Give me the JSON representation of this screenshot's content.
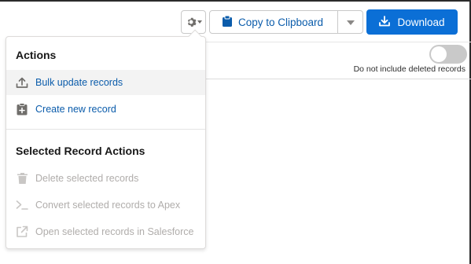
{
  "toolbar": {
    "copy_label": "Copy to Clipboard",
    "download_label": "Download"
  },
  "filters": {
    "toggle_label": "Do not include deleted records",
    "toggle_on": false
  },
  "menu": {
    "actions_heading": "Actions",
    "actions": [
      {
        "label": "Bulk update records",
        "icon": "upload-icon",
        "enabled": true
      },
      {
        "label": "Create new record",
        "icon": "new-record-icon",
        "enabled": true
      }
    ],
    "selected_heading": "Selected Record Actions",
    "selected_actions": [
      {
        "label": "Delete selected records",
        "icon": "trash-icon",
        "enabled": false
      },
      {
        "label": "Convert selected records to Apex",
        "icon": "terminal-icon",
        "enabled": false
      },
      {
        "label": "Open selected records in Salesforce",
        "icon": "external-link-icon",
        "enabled": false
      }
    ]
  },
  "colors": {
    "brand_blue": "#0b6fd6",
    "link_blue": "#0b5cab",
    "disabled_gray": "#b0adab"
  }
}
